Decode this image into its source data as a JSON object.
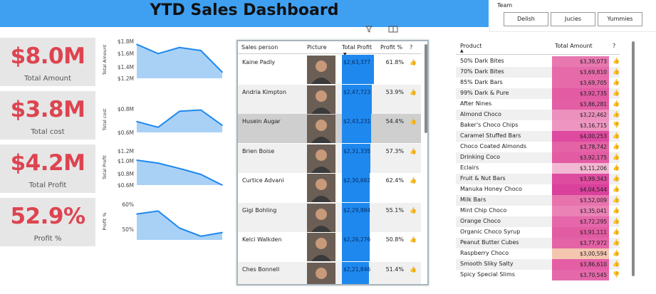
{
  "header": {
    "title": "YTD Sales Dashboard"
  },
  "slicer": {
    "title": "Team",
    "options": [
      "Delish",
      "Jucies",
      "Yummies"
    ]
  },
  "kpis": [
    {
      "value": "$8.0M",
      "label": "Total Amount"
    },
    {
      "value": "$3.8M",
      "label": "Total cost"
    },
    {
      "value": "$4.2M",
      "label": "Total Profit"
    },
    {
      "value": "52.9%",
      "label": "Profit %"
    }
  ],
  "chart_data": [
    {
      "type": "area",
      "ylabel": "Total Amount",
      "yticks": [
        "$1.8M",
        "$1.6M",
        "$1.4M",
        "$1.2M"
      ],
      "ylim": [
        1.2,
        1.8
      ],
      "values": [
        1.75,
        1.6,
        1.7,
        1.65,
        1.3
      ]
    },
    {
      "type": "area",
      "ylabel": "Total cost",
      "yticks": [
        "$0.8M",
        "$0.6M"
      ],
      "ylim": [
        0.55,
        0.95
      ],
      "values": [
        0.72,
        0.63,
        0.88,
        0.9,
        0.66
      ]
    },
    {
      "type": "area",
      "ylabel": "Total Profit",
      "yticks": [
        "$1.2M",
        "$1.0M",
        "$0.8M",
        "$0.6M"
      ],
      "ylim": [
        0.6,
        1.2
      ],
      "values": [
        1.02,
        0.97,
        0.88,
        0.78,
        0.6
      ]
    },
    {
      "type": "area",
      "ylabel": "Profit %",
      "yticks": [
        "60%",
        "50%"
      ],
      "ylim": [
        40,
        65
      ],
      "values": [
        57.5,
        59.5,
        48.0,
        42.5,
        45.0
      ]
    }
  ],
  "salesTable": {
    "headers": [
      "Sales person",
      "Picture",
      "Total Profit",
      "Profit %",
      "?"
    ],
    "rows": [
      {
        "name": "Kaine Padly",
        "profit": "$2,63,377",
        "pct": "61.8%",
        "fill": 1.0
      },
      {
        "name": "Andria Kimpton",
        "profit": "$2,47,723",
        "pct": "53.9%",
        "fill": 0.94
      },
      {
        "name": "Husein Augar",
        "profit": "$2,43,231",
        "pct": "54.4%",
        "fill": 0.92
      },
      {
        "name": "Brien Boise",
        "profit": "$2,31,335",
        "pct": "57.3%",
        "fill": 0.88
      },
      {
        "name": "Curtice Advani",
        "profit": "$2,30,662",
        "pct": "62.4%",
        "fill": 0.87
      },
      {
        "name": "Gigi Bohling",
        "profit": "$2,29,884",
        "pct": "55.1%",
        "fill": 0.87
      },
      {
        "name": "Kelci Walkden",
        "profit": "$2,26,276",
        "pct": "50.8%",
        "fill": 0.86
      },
      {
        "name": "Ches Bonnell",
        "profit": "$2,21,846",
        "pct": "51.4%",
        "fill": 0.84
      }
    ]
  },
  "productTable": {
    "headers": [
      "Product",
      "Total Amount",
      "?"
    ],
    "rows": [
      {
        "product": "50% Dark Bites",
        "amount": "$3,39,073",
        "color": "#e778b0",
        "thumb": "up"
      },
      {
        "product": "70% Dark Bites",
        "amount": "$3,69,810",
        "color": "#e66aaa",
        "thumb": "up"
      },
      {
        "product": "85% Dark Bars",
        "amount": "$3,69,705",
        "color": "#e66aaa",
        "thumb": "up"
      },
      {
        "product": "99% Dark & Pure",
        "amount": "$3,92,735",
        "color": "#e25ba3",
        "thumb": "up"
      },
      {
        "product": "After Nines",
        "amount": "$3,86,281",
        "color": "#e35ea5",
        "thumb": "up"
      },
      {
        "product": "Almond Choco",
        "amount": "$3,22,462",
        "color": "#ec90bd",
        "thumb": "up"
      },
      {
        "product": "Baker's Choco Chips",
        "amount": "$3,16,715",
        "color": "#ee96c1",
        "thumb": "down"
      },
      {
        "product": "Caramel Stuffed Bars",
        "amount": "$4,00,253",
        "color": "#dd4aa0",
        "thumb": "up"
      },
      {
        "product": "Choco Coated Almonds",
        "amount": "$3,78,742",
        "color": "#e463a7",
        "thumb": "up"
      },
      {
        "product": "Drinking Coco",
        "amount": "$3,92,175",
        "color": "#e25ba3",
        "thumb": "up"
      },
      {
        "product": "Eclairs",
        "amount": "$3,11,206",
        "color": "#f3b8d3",
        "thumb": "up"
      },
      {
        "product": "Fruit & Nut Bars",
        "amount": "$3,99,343",
        "color": "#de4ca0",
        "thumb": "up"
      },
      {
        "product": "Manuka Honey Choco",
        "amount": "$4,04,544",
        "color": "#d9419c",
        "thumb": "up"
      },
      {
        "product": "Milk Bars",
        "amount": "$3,52,009",
        "color": "#e773ad",
        "thumb": "up"
      },
      {
        "product": "Mint Chip Choco",
        "amount": "$3,35,041",
        "color": "#ea82b6",
        "thumb": "up"
      },
      {
        "product": "Orange Choco",
        "amount": "$3,72,295",
        "color": "#e566aa",
        "thumb": "up"
      },
      {
        "product": "Organic Choco Syrup",
        "amount": "$3,91,111",
        "color": "#e25ca3",
        "thumb": "up"
      },
      {
        "product": "Peanut Butter Cubes",
        "amount": "$3,77,972",
        "color": "#e463a7",
        "thumb": "up"
      },
      {
        "product": "Raspberry Choco",
        "amount": "$3,00,594",
        "color": "#f4c6b0",
        "thumb": "up"
      },
      {
        "product": "Smooth Sliky Salty",
        "amount": "$3,86,610",
        "color": "#e35ea5",
        "thumb": "up"
      },
      {
        "product": "Spicy Special Slims",
        "amount": "$3,70,545",
        "color": "#e569aa",
        "thumb": "down"
      }
    ]
  },
  "colors": {
    "header": "#3fa0f2",
    "kpiValue": "#dd4450",
    "area": "#a9d1f6",
    "line": "#1e88ee",
    "bar": "#1e88ee",
    "thumb": "#e8a020"
  }
}
